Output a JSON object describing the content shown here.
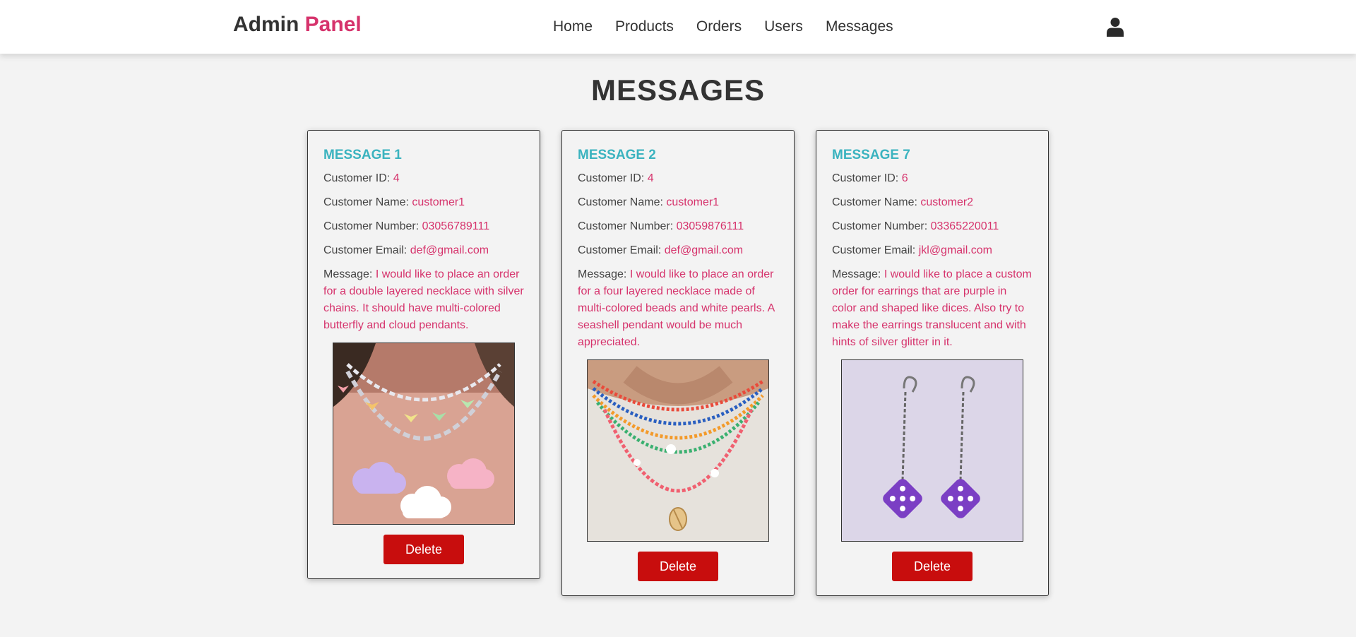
{
  "brand": {
    "name": "Admin",
    "accent": "Panel",
    "accent_color": "#d6336c"
  },
  "nav": [
    {
      "label": "Home"
    },
    {
      "label": "Products"
    },
    {
      "label": "Orders"
    },
    {
      "label": "Users"
    },
    {
      "label": "Messages"
    }
  ],
  "user_icon": "user-icon",
  "page_title": "MESSAGES",
  "field_labels": {
    "customer_id": "Customer ID:",
    "customer_name": "Customer Name:",
    "customer_number": "Customer Number:",
    "customer_email": "Customer Email:",
    "message": "Message:"
  },
  "messages": [
    {
      "title": "MESSAGE 1",
      "customer_id": "4",
      "customer_name": "customer1",
      "customer_number": "03056789111",
      "customer_email": "def@gmail.com",
      "message": "I would like to place an order for a double layered necklace with silver chains. It should have multi-colored butterfly and cloud pendants.",
      "delete_label": "Delete"
    },
    {
      "title": "MESSAGE 2",
      "customer_id": "4",
      "customer_name": "customer1",
      "customer_number": "03059876111",
      "customer_email": "def@gmail.com",
      "message": "I would like to place an order for a four layered necklace made of multi-colored beads and white pearls. A seashell pendant would be much appreciated.",
      "delete_label": "Delete"
    },
    {
      "title": "MESSAGE 7",
      "customer_id": "6",
      "customer_name": "customer2",
      "customer_number": "03365220011",
      "customer_email": "jkl@gmail.com",
      "message": "I would like to place a custom order for earrings that are purple in color and shaped like dices. Also try to make the earrings translucent and with hints of silver glitter in it.",
      "delete_label": "Delete"
    }
  ],
  "colors": {
    "heading_teal": "#3bb3bf",
    "value_pink": "#d6336c",
    "delete_red": "#c80d0d",
    "background": "#f3f3f3"
  }
}
